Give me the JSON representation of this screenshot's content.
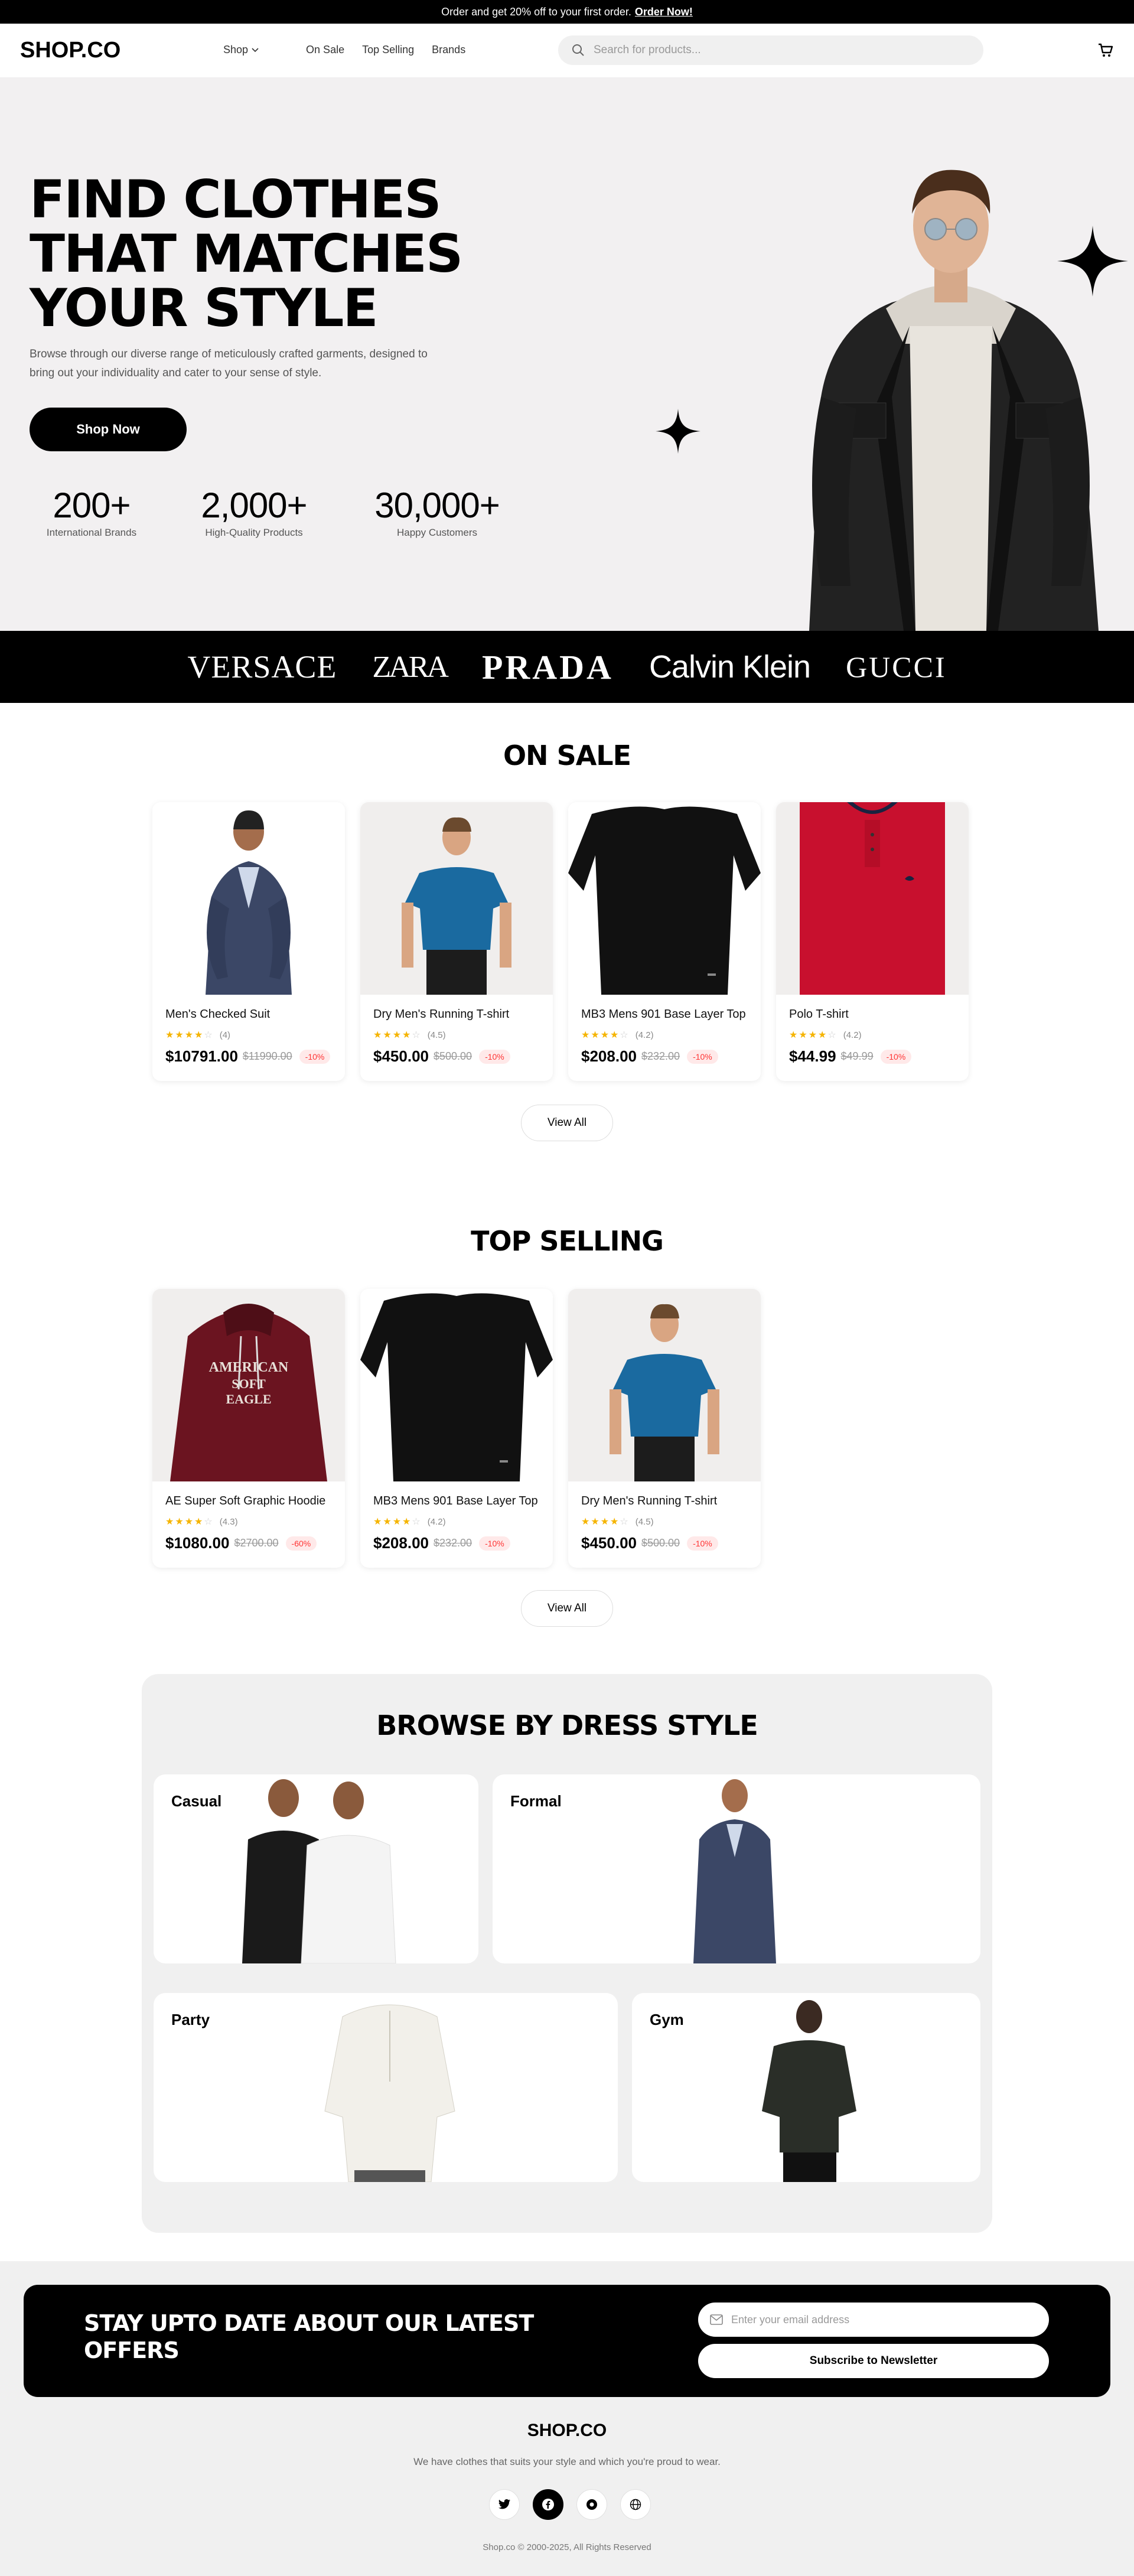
{
  "announcement": {
    "text": "Order and get 20% off to your first order.",
    "link": "Order Now!"
  },
  "header": {
    "logo": "SHOP.CO",
    "nav": [
      "Shop",
      "On Sale",
      "Top Selling",
      "Brands"
    ],
    "search_placeholder": "Search for products..."
  },
  "hero": {
    "title_line1": "FIND CLOTHES",
    "title_line2": "THAT MATCHES",
    "title_line3": "YOUR STYLE",
    "description": "Browse through our diverse range of meticulously crafted garments, designed to bring out your individuality and cater to your sense of style.",
    "cta": "Shop Now",
    "stats": [
      {
        "value": "200+",
        "label": "International Brands"
      },
      {
        "value": "2,000+",
        "label": "High-Quality Products"
      },
      {
        "value": "30,000+",
        "label": "Happy Customers"
      }
    ]
  },
  "brands": [
    "VERSACE",
    "ZARA",
    "PRADA",
    "Calvin Klein",
    "GUCCI"
  ],
  "on_sale": {
    "title": "ON SALE",
    "view_all": "View All",
    "products": [
      {
        "name": "Men's Checked Suit",
        "rating": 4,
        "rating_text": "(4)",
        "price": "$10791.00",
        "old_price": "$11990.00",
        "discount": "-10%"
      },
      {
        "name": "Dry Men's Running T-shirt",
        "rating": 4.5,
        "rating_text": "(4.5)",
        "price": "$450.00",
        "old_price": "$500.00",
        "discount": "-10%"
      },
      {
        "name": "MB3 Mens 901 Base Layer Top",
        "rating": 4.2,
        "rating_text": "(4.2)",
        "price": "$208.00",
        "old_price": "$232.00",
        "discount": "-10%"
      },
      {
        "name": "Polo T-shirt",
        "rating": 4.2,
        "rating_text": "(4.2)",
        "price": "$44.99",
        "old_price": "$49.99",
        "discount": "-10%"
      }
    ]
  },
  "top_selling": {
    "title": "TOP SELLING",
    "view_all": "View All",
    "products": [
      {
        "name": "AE Super Soft Graphic Hoodie",
        "rating": 4.3,
        "rating_text": "(4.3)",
        "price": "$1080.00",
        "old_price": "$2700.00",
        "discount": "-60%"
      },
      {
        "name": "MB3 Mens 901 Base Layer Top",
        "rating": 4.2,
        "rating_text": "(4.2)",
        "price": "$208.00",
        "old_price": "$232.00",
        "discount": "-10%"
      },
      {
        "name": "Dry Men's Running T-shirt",
        "rating": 4.5,
        "rating_text": "(4.5)",
        "price": "$450.00",
        "old_price": "$500.00",
        "discount": "-10%"
      }
    ]
  },
  "browse": {
    "title": "BROWSE BY DRESS STYLE",
    "styles": [
      "Casual",
      "Formal",
      "Party",
      "Gym"
    ]
  },
  "newsletter": {
    "title_line1": "STAY UPTO DATE ABOUT OUR LATEST",
    "title_line2": "OFFERS",
    "placeholder": "Enter your email address",
    "button": "Subscribe to Newsletter"
  },
  "footer": {
    "logo": "SHOP.CO",
    "tagline": "We have clothes that suits your style and which you're proud to wear.",
    "socials": [
      "twitter-icon",
      "facebook-icon",
      "instagram-icon",
      "globe-icon"
    ],
    "copyright": "Shop.co © 2000-2025, All Rights Reserved"
  },
  "colors": {
    "accent": "#000000",
    "star": "#f5b400",
    "discount": "#ff3333",
    "hero_bg": "#f2f0f1"
  }
}
